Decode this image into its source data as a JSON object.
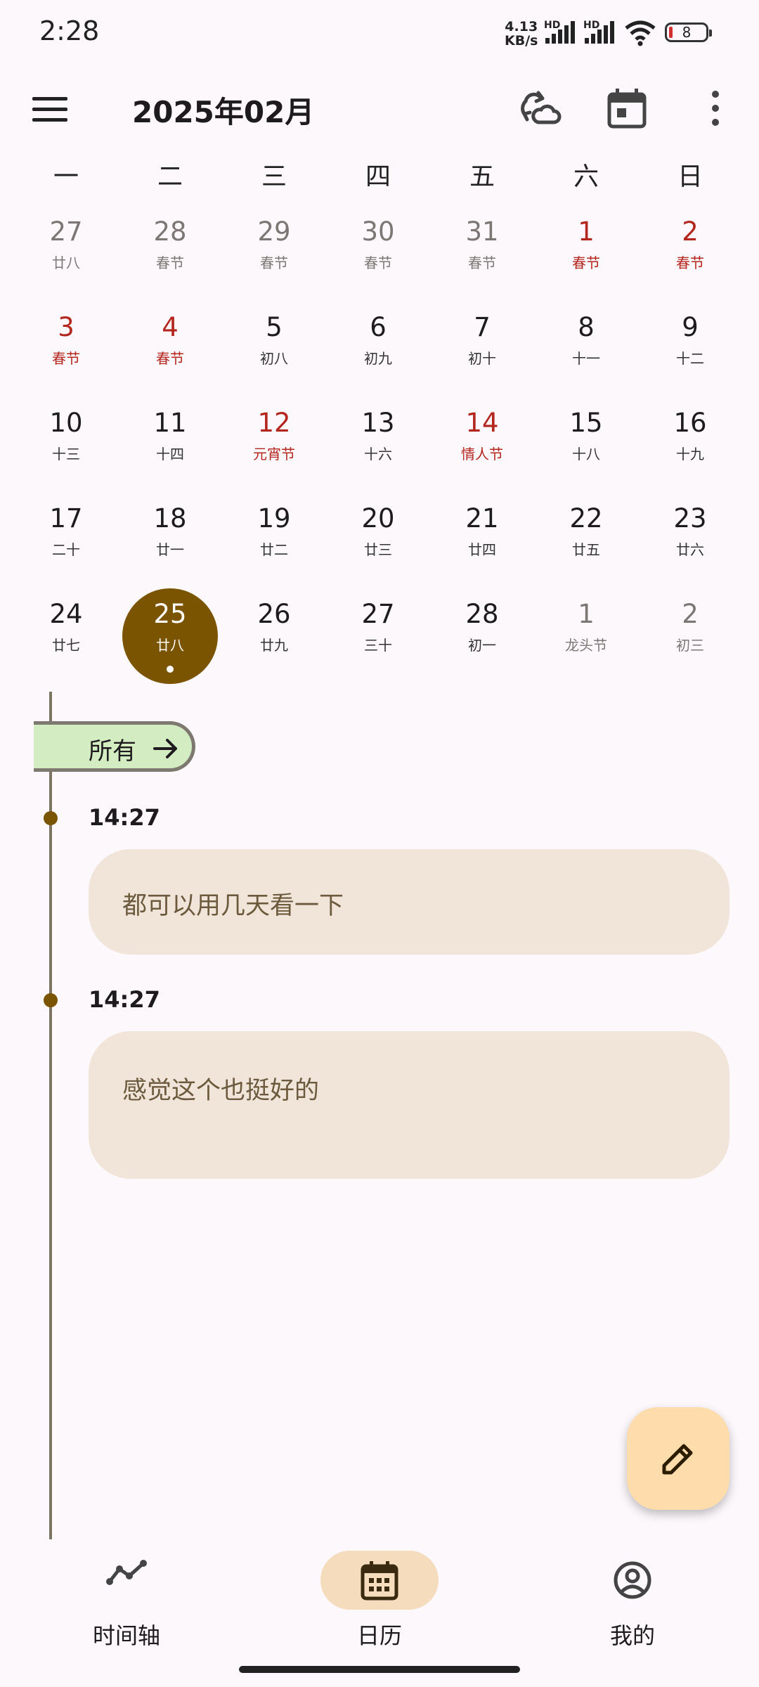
{
  "status_bar": {
    "time": "2:28",
    "net_speed_value": "4.13",
    "net_speed_unit": "KB/s",
    "sim1_label": "HD",
    "sim2_label": "HD",
    "battery": "8"
  },
  "app_bar": {
    "title": "2025年02月",
    "menu_icon": "hamburger-menu-icon",
    "sync_icon": "cloud-sync-icon",
    "today_icon": "calendar-today-icon",
    "more_icon": "more-vert-icon"
  },
  "weekdays": [
    "一",
    "二",
    "三",
    "四",
    "五",
    "六",
    "日"
  ],
  "calendar": {
    "weeks": [
      [
        {
          "day": "27",
          "lunar": "廿八",
          "style": "muted"
        },
        {
          "day": "28",
          "lunar": "春节",
          "style": "muted"
        },
        {
          "day": "29",
          "lunar": "春节",
          "style": "muted"
        },
        {
          "day": "30",
          "lunar": "春节",
          "style": "muted"
        },
        {
          "day": "31",
          "lunar": "春节",
          "style": "muted"
        },
        {
          "day": "1",
          "lunar": "春节",
          "style": "red"
        },
        {
          "day": "2",
          "lunar": "春节",
          "style": "red"
        }
      ],
      [
        {
          "day": "3",
          "lunar": "春节",
          "style": "red"
        },
        {
          "day": "4",
          "lunar": "春节",
          "style": "red"
        },
        {
          "day": "5",
          "lunar": "初八",
          "style": "normal"
        },
        {
          "day": "6",
          "lunar": "初九",
          "style": "normal"
        },
        {
          "day": "7",
          "lunar": "初十",
          "style": "normal"
        },
        {
          "day": "8",
          "lunar": "十一",
          "style": "normal"
        },
        {
          "day": "9",
          "lunar": "十二",
          "style": "normal"
        }
      ],
      [
        {
          "day": "10",
          "lunar": "十三",
          "style": "normal"
        },
        {
          "day": "11",
          "lunar": "十四",
          "style": "normal"
        },
        {
          "day": "12",
          "lunar": "元宵节",
          "style": "red"
        },
        {
          "day": "13",
          "lunar": "十六",
          "style": "normal"
        },
        {
          "day": "14",
          "lunar": "情人节",
          "style": "red"
        },
        {
          "day": "15",
          "lunar": "十八",
          "style": "normal"
        },
        {
          "day": "16",
          "lunar": "十九",
          "style": "normal"
        }
      ],
      [
        {
          "day": "17",
          "lunar": "二十",
          "style": "normal"
        },
        {
          "day": "18",
          "lunar": "廿一",
          "style": "normal"
        },
        {
          "day": "19",
          "lunar": "廿二",
          "style": "normal"
        },
        {
          "day": "20",
          "lunar": "廿三",
          "style": "normal"
        },
        {
          "day": "21",
          "lunar": "廿四",
          "style": "normal"
        },
        {
          "day": "22",
          "lunar": "廿五",
          "style": "normal"
        },
        {
          "day": "23",
          "lunar": "廿六",
          "style": "normal"
        }
      ],
      [
        {
          "day": "24",
          "lunar": "廿七",
          "style": "normal"
        },
        {
          "day": "25",
          "lunar": "廿八",
          "style": "selected"
        },
        {
          "day": "26",
          "lunar": "廿九",
          "style": "normal"
        },
        {
          "day": "27",
          "lunar": "三十",
          "style": "normal"
        },
        {
          "day": "28",
          "lunar": "初一",
          "style": "normal"
        },
        {
          "day": "1",
          "lunar": "龙头节",
          "style": "muted"
        },
        {
          "day": "2",
          "lunar": "初三",
          "style": "muted"
        }
      ]
    ]
  },
  "timeline": {
    "filter_label": "所有",
    "filter_icon": "arrow-right-icon",
    "entries": [
      {
        "time": "14:27",
        "text": "都可以用几天看一下"
      },
      {
        "time": "14:27",
        "text": "感觉这个也挺好的"
      }
    ]
  },
  "fab": {
    "icon": "edit-pencil-icon"
  },
  "bottom_nav": [
    {
      "label": "时间轴",
      "icon": "timeline-icon",
      "active": false
    },
    {
      "label": "日历",
      "icon": "calendar-icon",
      "active": true
    },
    {
      "label": "我的",
      "icon": "account-circle-icon",
      "active": false
    }
  ],
  "colors": {
    "accent": "#7b5400",
    "holiday_red": "#b3261e",
    "card_bg": "#f0e5d8",
    "chip_bg": "#d3ecc2",
    "fab_bg": "#ffdcab",
    "nav_active_pill": "#f4dcbd"
  }
}
